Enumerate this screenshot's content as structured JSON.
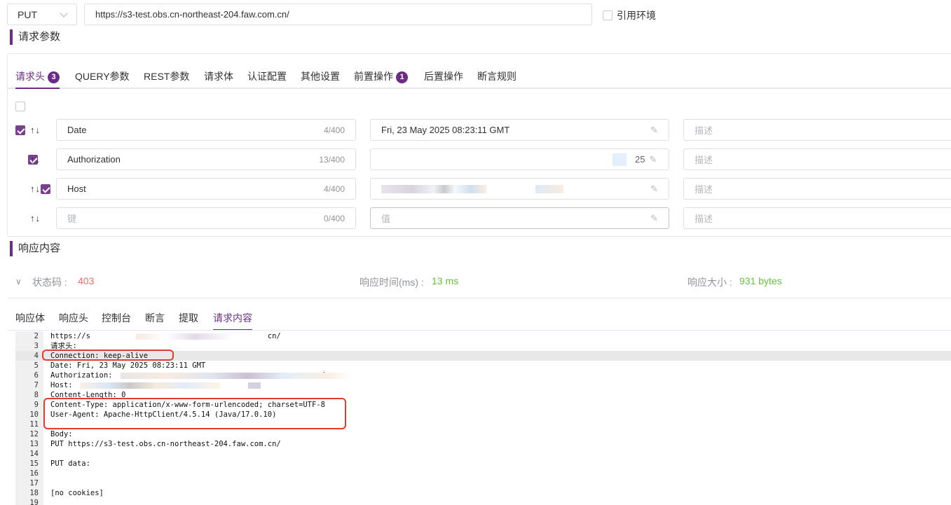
{
  "url_bar": {
    "method": "PUT",
    "url": "https://s3-test.obs.cn-northeast-204.faw.com.cn/",
    "use_env_label": "引用环境"
  },
  "request_section": {
    "title": "请求参数"
  },
  "tabs": [
    {
      "label": "请求头",
      "badge": "3"
    },
    {
      "label": "QUERY参数"
    },
    {
      "label": "REST参数"
    },
    {
      "label": "请求体"
    },
    {
      "label": "认证配置"
    },
    {
      "label": "其他设置"
    },
    {
      "label": "前置操作",
      "badge": "1"
    },
    {
      "label": "后置操作"
    },
    {
      "label": "断言规则"
    }
  ],
  "headers": [
    {
      "key": "Date",
      "count": "4/400",
      "value": "Fri, 23 May 2025 08:23:11 GMT",
      "desc": "描述",
      "checked": true
    },
    {
      "key": "Authorization",
      "count": "13/400",
      "value": "25",
      "desc": "描述",
      "checked": true
    },
    {
      "key": "Host",
      "count": "4/400",
      "value": "",
      "desc": "描述",
      "checked": true
    },
    {
      "key": "",
      "key_placeholder": "键",
      "count": "0/400",
      "value": "",
      "value_placeholder": "值",
      "desc": "描述",
      "checked": false
    }
  ],
  "response_section": {
    "title": "响应内容"
  },
  "status": {
    "code_label": "状态码 :",
    "code": "403",
    "time_label": "响应时间(ms) :",
    "time": "13 ms",
    "size_label": "响应大小 :",
    "size": "931 bytes",
    "error_color": "#f56c6c",
    "ok_color": "#67c23a"
  },
  "response_tabs": [
    "响应体",
    "响应头",
    "控制台",
    "断言",
    "提取",
    "请求内容"
  ],
  "code_lines": [
    {
      "n": "2",
      "t": "https://s                                        cn/"
    },
    {
      "n": "3",
      "t": "请求头:"
    },
    {
      "n": "4",
      "t": "Connection: keep-alive"
    },
    {
      "n": "5",
      "t": "Date: Fri, 23 May 2025 08:23:11 GMT"
    },
    {
      "n": "6",
      "t": "Authorization:                                               dg="
    },
    {
      "n": "7",
      "t": "Host:"
    },
    {
      "n": "8",
      "t": "Content-Length: 0"
    },
    {
      "n": "9",
      "t": "Content-Type: application/x-www-form-urlencoded; charset=UTF-8"
    },
    {
      "n": "10",
      "t": "User-Agent: Apache-HttpClient/4.5.14 (Java/17.0.10)"
    },
    {
      "n": "11",
      "t": ""
    },
    {
      "n": "12",
      "t": "Body:"
    },
    {
      "n": "13",
      "t": "PUT https://s3-test.obs.cn-northeast-204.faw.com.cn/"
    },
    {
      "n": "14",
      "t": ""
    },
    {
      "n": "15",
      "t": "PUT data:"
    },
    {
      "n": "16",
      "t": ""
    },
    {
      "n": "17",
      "t": ""
    },
    {
      "n": "18",
      "t": "[no cookies]"
    },
    {
      "n": "19",
      "t": ""
    }
  ],
  "accent_color": "#6b2d84"
}
